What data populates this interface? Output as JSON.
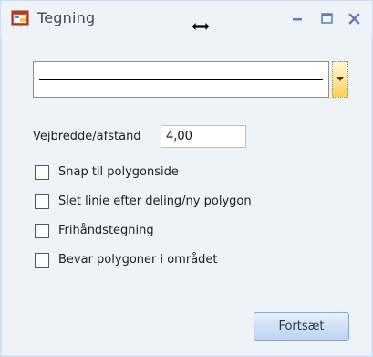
{
  "window": {
    "title": "Tegning",
    "colors": {
      "background": "#eef3fa",
      "titlebar_buttons": "#5b7fb3",
      "dropdown_accent": "#fccd58"
    }
  },
  "line_style_dropdown": {
    "selected": "solid line",
    "icon": "chevron-down-icon"
  },
  "road_width": {
    "label": "Vejbredde/afstand",
    "value": "4,00"
  },
  "options": [
    {
      "label": "Snap til polygonside",
      "checked": false
    },
    {
      "label": "Slet linie efter deling/ny polygon",
      "checked": false
    },
    {
      "label": "Frihåndstegning",
      "checked": false
    },
    {
      "label": "Bevar polygoner i området",
      "checked": false
    }
  ],
  "continue_button": {
    "label": "Fortsæt"
  }
}
